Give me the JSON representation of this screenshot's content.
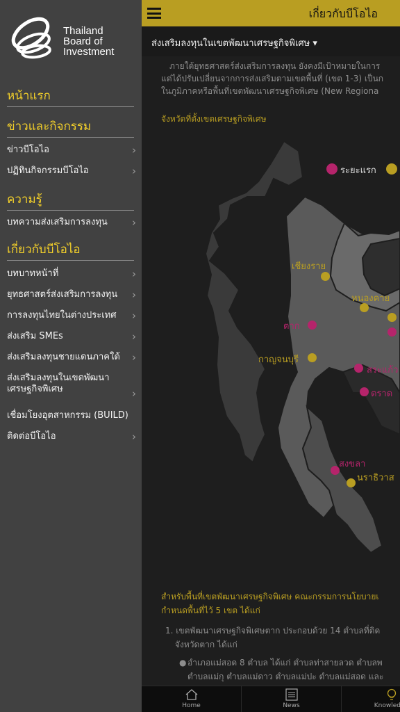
{
  "logo": {
    "line1": "Thailand",
    "line2": "Board of",
    "line3": "Investment"
  },
  "drawer": {
    "home": "หน้าแรก",
    "news_section": "ข่าวและกิจกรรม",
    "news_items": [
      "ข่าวบีโอไอ",
      "ปฏิทินกิจกรรมบีโอไอ"
    ],
    "knowledge_section": "ความรู้",
    "knowledge_items": [
      "บทความส่งเสริมการลงทุน"
    ],
    "about_section": "เกี่ยวกับบีโอไอ",
    "about_items": [
      "บทบาทหน้าที่",
      "ยุทธศาสตร์ส่งเสริมการลงทุน",
      "การลงทุนไทยในต่างประเทศ",
      "ส่งเสริม SMEs",
      "ส่งเสริมลงทุนชายแดนภาคใต้",
      "ส่งเสริมลงทุนในเขตพัฒนา",
      "เศรษฐกิจพิเศษ",
      "เชื่อมโยงอุตสาหกรรม (BUILD)",
      "ติดต่อบีโอไอ"
    ]
  },
  "header": {
    "title": "เกี่ยวกับบีโอไอ"
  },
  "subheader": {
    "label": "ส่งเสริมลงทุนในเขตพัฒนาเศรษฐกิจพิเศษ ▾"
  },
  "intro": {
    "line1": "ภายใต้ยุทธศาสตร์ส่งเสริมการลงทุน ยังคงมีเป้าหมายในการ",
    "line2": "แต่ได้ปรับเปลี่ยนจากการส่งเสริมตามเขตพื้นที่ (เขต 1-3) เป็นก",
    "line3": "ในภูมิภาคหรือพื้นที่เขตพัฒนาเศรษฐกิจพิเศษ (New Regiona"
  },
  "map": {
    "title": "จังหวัดที่ตั้งเขตเศรษฐกิจพิเศษ",
    "legend_phase1": "ระยะแรก",
    "colors": {
      "phase1": "#b5246b",
      "phase2": "#b99e22"
    },
    "labels": {
      "chiangrai": "เชียงราย",
      "nongkhai": "หนองคาย",
      "tak": "ตาก",
      "kanchanaburi": "กาญจนบุรี",
      "sakaeo": "สระแก้ว",
      "trat": "ตราด",
      "songkhla": "สงขลา",
      "narathiwat": "นราธิวาส"
    }
  },
  "body": {
    "line1": "สำหรับพื้นที่เขตพัฒนาเศรษฐกิจพิเศษ คณะกรรมการนโยบายเ",
    "line2": "กำหนดพื้นที่ไว้ 5 เขต ได้แก่",
    "line3": "1. เขตพัฒนาเศรษฐกิจพิเศษตาก ประกอบด้วย 14 ตำบลที่ติด",
    "line4": "จังหวัดตาก ได้แก่",
    "line5": "อำเภอแม่สอด 8 ตำบล ได้แก่ ตำบลท่าสายลวด ตำบลพ",
    "line6": "ตำบลแม่กุ ตำบลแม่ดาว ตำบลแม่ปะ ตำบลแม่สอด และ"
  },
  "tabs": {
    "home": "Home",
    "news": "News",
    "knowledge": "Knowledge"
  }
}
